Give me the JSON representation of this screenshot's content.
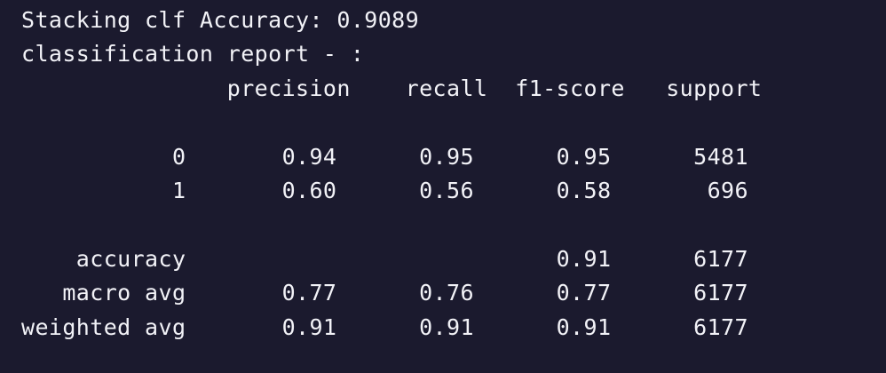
{
  "output": {
    "accuracy_line": "Stacking clf Accuracy: 0.9089",
    "report_title": "classification report - :",
    "header_row": "               precision    recall  f1-score   support",
    "blank_1": "",
    "row_class_0": "           0       0.94      0.95      0.95      5481",
    "row_class_1": "           1       0.60      0.56      0.58       696",
    "blank_2": "",
    "row_accuracy": "    accuracy                           0.91      6177",
    "row_macro_avg": "   macro avg       0.77      0.76      0.77      6177",
    "row_weighted_avg": "weighted avg       0.91      0.91      0.91      6177"
  },
  "colors": {
    "background": "#1b1a2e",
    "text": "#f2f2f7"
  }
}
